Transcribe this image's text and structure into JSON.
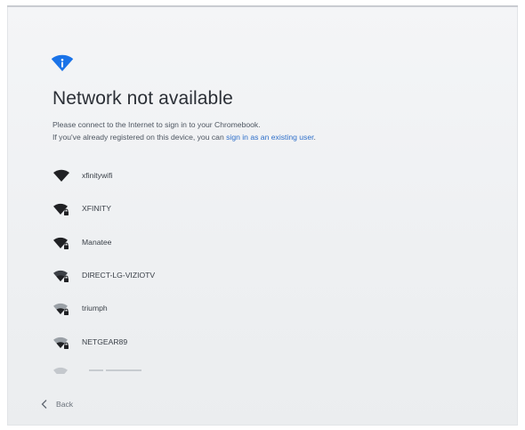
{
  "page": {
    "title": "Network not available",
    "description_line1": "Please connect to the Internet to sign in to your Chromebook.",
    "description_line2_prefix": "If you've already registered on this device, you can ",
    "description_line2_link": "sign in as an existing user",
    "description_line2_suffix": "."
  },
  "networks": [
    {
      "name": "xfinitywifi",
      "icon": "wifi-signal-icon",
      "secured": false
    },
    {
      "name": "XFINITY",
      "icon": "wifi-lock-icon",
      "secured": true
    },
    {
      "name": "Manatee",
      "icon": "wifi-lock-icon",
      "secured": true
    },
    {
      "name": "DIRECT-LG-VIZIOTV",
      "icon": "wifi-lock-icon",
      "secured": true
    },
    {
      "name": "triumph",
      "icon": "wifi-lock-icon",
      "secured": true
    },
    {
      "name": "NETGEAR89",
      "icon": "wifi-lock-icon",
      "secured": true
    }
  ],
  "footer": {
    "back_label": "Back"
  },
  "colors": {
    "accent": "#1a73e8",
    "link": "#2f6fc9",
    "title": "#2b2f36",
    "icon": "#202124"
  }
}
